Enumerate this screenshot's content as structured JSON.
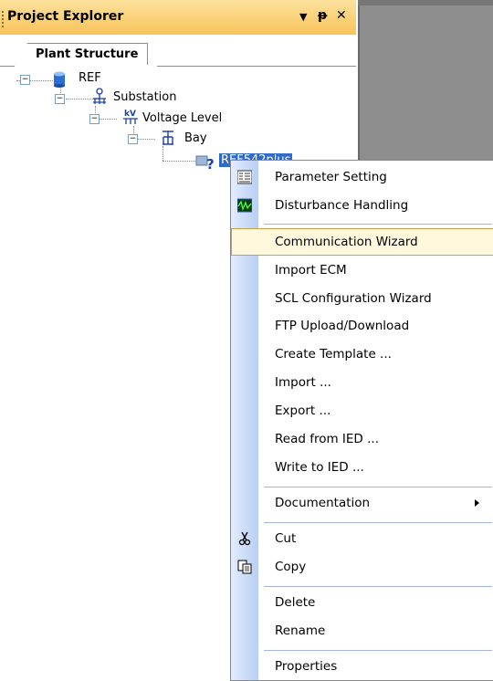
{
  "panel": {
    "title": "Project Explorer",
    "controls": {
      "dropdown": "▼",
      "pin": "ᵽ",
      "close": "✕"
    }
  },
  "tabs": [
    {
      "label": "Plant Structure"
    }
  ],
  "tree": {
    "root": "REF",
    "substation": "Substation",
    "voltage_level": "Voltage Level",
    "bay": "Bay",
    "ied": "REF542plus"
  },
  "context_menu": {
    "items": [
      {
        "label": "Parameter Setting",
        "icon": "parameter-icon"
      },
      {
        "label": "Disturbance Handling",
        "icon": "disturbance-icon"
      },
      {
        "label": "Communication Wizard"
      },
      {
        "label": "Import ECM"
      },
      {
        "label": "SCL Configuration Wizard"
      },
      {
        "label": "FTP Upload/Download"
      },
      {
        "label": "Create Template ..."
      },
      {
        "label": "Import ..."
      },
      {
        "label": "Export ..."
      },
      {
        "label": "Read from IED ..."
      },
      {
        "label": "Write to IED ..."
      },
      {
        "label": "Documentation"
      },
      {
        "label": "Cut",
        "icon": "scissors-icon"
      },
      {
        "label": "Copy",
        "icon": "copy-icon"
      },
      {
        "label": "Delete"
      },
      {
        "label": "Rename"
      },
      {
        "label": "Properties"
      }
    ],
    "highlighted": "Communication Wizard"
  },
  "colors": {
    "titlebar": "#f7c35a",
    "selection": "#316ac5",
    "menu_strip": "#b8cef3",
    "highlight": "#fff8dc",
    "right_pane": "#8e8e8e"
  }
}
